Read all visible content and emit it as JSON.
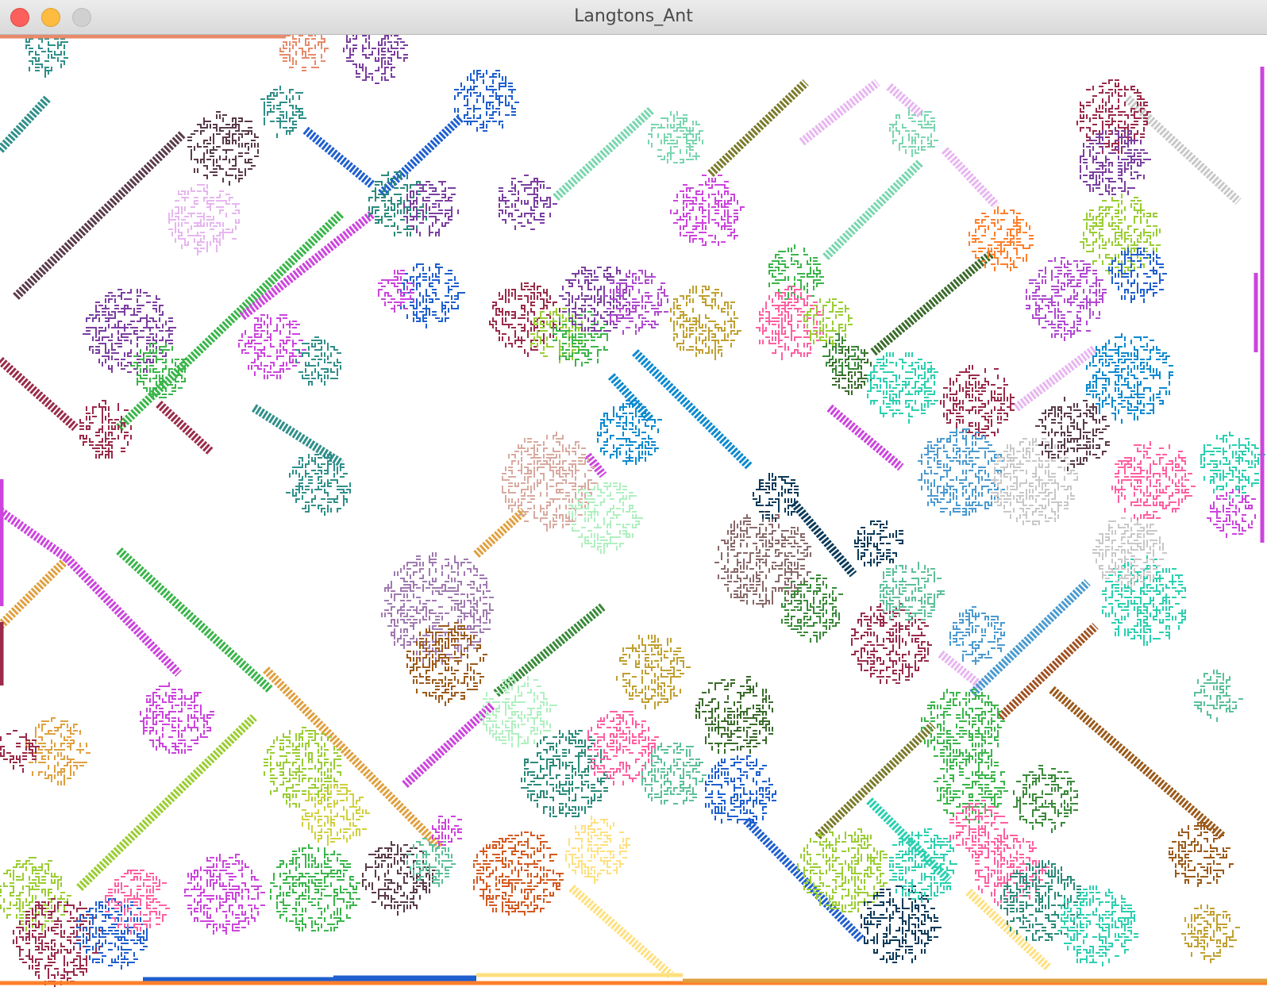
{
  "window": {
    "title": "Langtons_Ant",
    "buttons": {
      "close": "close",
      "minimize": "minimize",
      "zoom": "zoom"
    }
  },
  "colors": {
    "titlebar": "#e3e3e3",
    "close": "#fc605c",
    "minimize": "#fdbc40",
    "zoom": "#d0d0d0",
    "canvas_background": "#ffffff"
  },
  "simulation": {
    "palette": [
      "#5a3b4a",
      "#2f8f8a",
      "#7b3fa0",
      "#cc44dd",
      "#1f5fcf",
      "#7ad6b0",
      "#e88a6a",
      "#9a2b4a",
      "#3ab54a",
      "#e7b6f0",
      "#b04ad0",
      "#9acd32",
      "#3a6b2a",
      "#ff7f2a",
      "#2a8a7a",
      "#6fbfd0",
      "#0a8ad0",
      "#5cc09a",
      "#d8aaa0",
      "#c0a030",
      "#ff5fa0",
      "#2ad0b0",
      "#c8c8c8",
      "#a05020",
      "#7a7a2a",
      "#a07ab0",
      "#3a8a3a",
      "#b0f0c0",
      "#d45a20",
      "#0a3a5a",
      "#4a9ad0",
      "#ffe080",
      "#9b5a1a",
      "#e0a040",
      "#c04080",
      "#6a8a2a",
      "#1a5acf",
      "#d0d040",
      "#8a6a6a",
      "#20b0a0"
    ]
  }
}
